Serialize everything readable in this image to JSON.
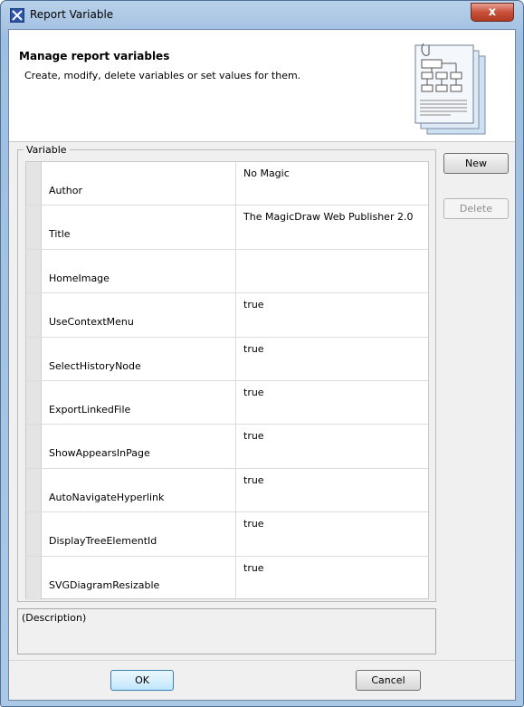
{
  "window": {
    "title": "Report Variable",
    "close_icon": "close-icon",
    "close_glyph": "x"
  },
  "header": {
    "title": "Manage report variables",
    "subtitle": "Create, modify, delete variables or set values for them.",
    "illustration_icon": "report-document-icon"
  },
  "variables": {
    "legend": "Variable",
    "rows": [
      {
        "name": "Author",
        "value": "No Magic"
      },
      {
        "name": "Title",
        "value": "The MagicDraw Web Publisher 2.0"
      },
      {
        "name": "HomeImage",
        "value": ""
      },
      {
        "name": "UseContextMenu",
        "value": "true"
      },
      {
        "name": "SelectHistoryNode",
        "value": "true"
      },
      {
        "name": "ExportLinkedFile",
        "value": "true"
      },
      {
        "name": "ShowAppearsInPage",
        "value": "true"
      },
      {
        "name": "AutoNavigateHyperlink",
        "value": "true"
      },
      {
        "name": "DisplayTreeElementId",
        "value": "true"
      },
      {
        "name": "SVGDiagramResizable",
        "value": "true"
      }
    ]
  },
  "actions": {
    "new_label": "New",
    "delete_label": "Delete",
    "delete_enabled": false
  },
  "description": {
    "label": "(Description)"
  },
  "footer": {
    "ok_label": "OK",
    "cancel_label": "Cancel"
  }
}
